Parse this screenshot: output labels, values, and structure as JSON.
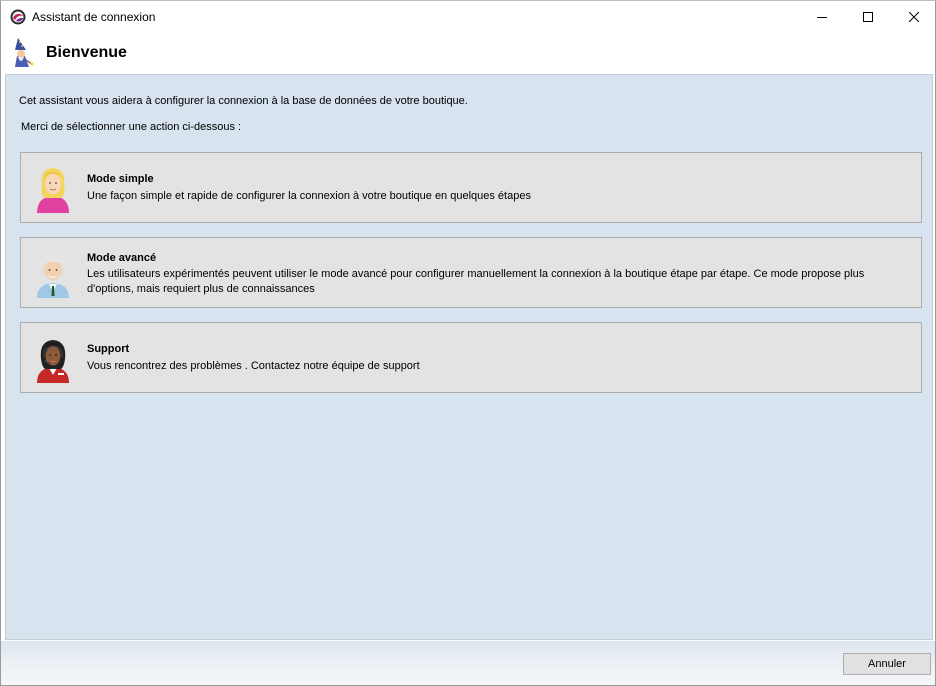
{
  "window": {
    "title": "Assistant de connexion",
    "app_icon": "app-logo-icon",
    "controls": [
      "minimize-icon",
      "maximize-icon",
      "close-icon"
    ]
  },
  "header": {
    "icon": "wizard-icon",
    "title": "Bienvenue"
  },
  "main": {
    "intro": "Cet assistant vous aidera à configurer la connexion à la base de données de votre boutique.",
    "prompt": "Merci de sélectionner une action ci-dessous :",
    "options": [
      {
        "icon": "blonde-user-icon",
        "title": "Mode simple",
        "description": "Une façon simple et rapide de configurer la connexion à votre boutique en quelques étapes"
      },
      {
        "icon": "expert-user-icon",
        "title": "Mode avancé",
        "description": "Les utilisateurs expérimentés peuvent utiliser le mode avancé pour configurer manuellement la connexion à la boutique étape par étape. Ce mode propose plus d'options, mais requiert plus de connaissances"
      },
      {
        "icon": "support-agent-icon",
        "title": "Support",
        "description": "Vous rencontrez des problèmes . Contactez notre équipe de support"
      }
    ]
  },
  "footer": {
    "cancel_label": "Annuler"
  },
  "colors": {
    "panel_background": "#d7e3ef",
    "option_background": "#e3e3e3",
    "option_border": "#adadad"
  }
}
